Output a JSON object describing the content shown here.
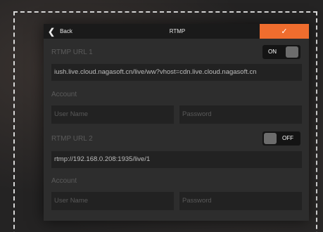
{
  "header": {
    "back_label": "Back",
    "title": "RTMP",
    "confirm_icon": "checkmark-icon"
  },
  "rtmp1": {
    "label": "RTMP URL 1",
    "toggle_state": "ON",
    "url": "iush.live.cloud.nagasoft.cn/live/ww?vhost=cdn.live.cloud.nagasoft.cn",
    "account_label": "Account",
    "username_placeholder": "User Name",
    "password_placeholder": "Password"
  },
  "rtmp2": {
    "label": "RTMP URL 2",
    "toggle_state": "OFF",
    "url": "rtmp://192.168.0.208:1935/live/1",
    "account_label": "Account",
    "username_placeholder": "User Name",
    "password_placeholder": "Password"
  },
  "colors": {
    "accent": "#ef6d2e",
    "panel": "#2d2d2d",
    "field": "#222222"
  }
}
